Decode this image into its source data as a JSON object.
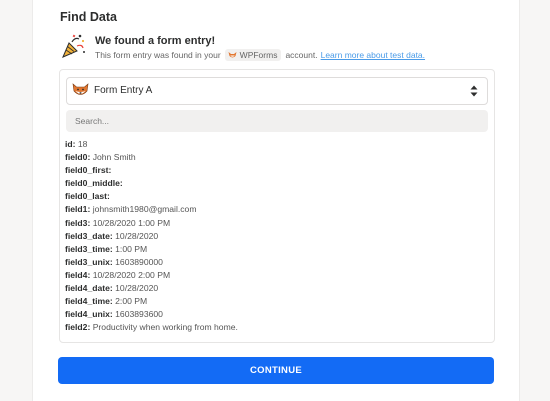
{
  "section": {
    "title": "Find Data"
  },
  "found": {
    "title": "We found a form entry!",
    "sub_before": "This form entry was found in your",
    "app_name": "WPForms",
    "sub_after": "account.",
    "link": "Learn more about test data.",
    "icon": "party-popper-icon"
  },
  "entry_select": {
    "label": "Form Entry A",
    "icon": "wpforms-fox-icon"
  },
  "search": {
    "placeholder": "Search..."
  },
  "fields": [
    {
      "key": "id:",
      "value": "18"
    },
    {
      "key": "field0:",
      "value": "John Smith"
    },
    {
      "key": "field0_first:",
      "value": ""
    },
    {
      "key": "field0_middle:",
      "value": ""
    },
    {
      "key": "field0_last:",
      "value": ""
    },
    {
      "key": "field1:",
      "value": "johnsmith1980@gmail.com"
    },
    {
      "key": "field3:",
      "value": "10/28/2020 1:00 PM"
    },
    {
      "key": "field3_date:",
      "value": "10/28/2020"
    },
    {
      "key": "field3_time:",
      "value": "1:00 PM"
    },
    {
      "key": "field3_unix:",
      "value": "1603890000"
    },
    {
      "key": "field4:",
      "value": "10/28/2020 2:00 PM"
    },
    {
      "key": "field4_date:",
      "value": "10/28/2020"
    },
    {
      "key": "field4_time:",
      "value": "2:00 PM"
    },
    {
      "key": "field4_unix:",
      "value": "1603893600"
    },
    {
      "key": "field2:",
      "value": "Productivity when working from home."
    }
  ],
  "continue_button": {
    "label": "CONTINUE"
  },
  "colors": {
    "primary": "#136bf5",
    "link": "#4a9be8",
    "background": "#f7f6f5"
  }
}
